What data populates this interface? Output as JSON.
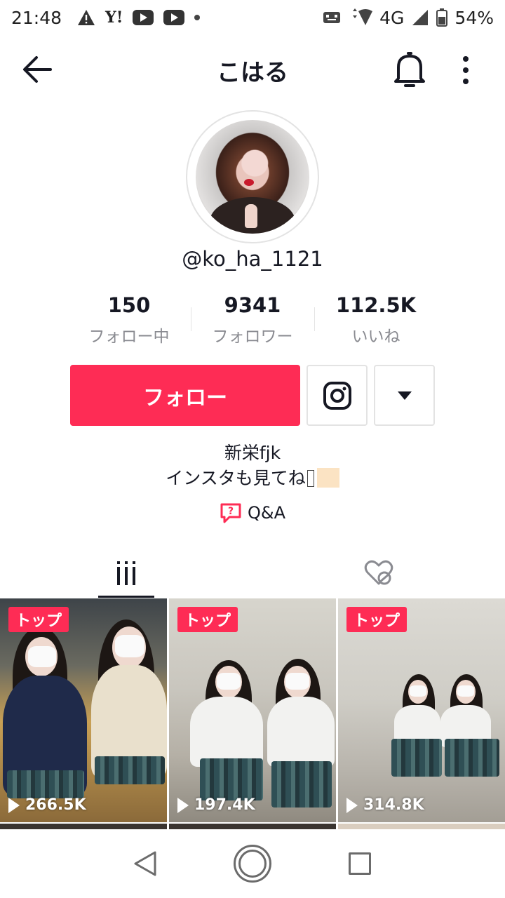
{
  "status_bar": {
    "time": "21:48",
    "network": "4G",
    "battery": "54%",
    "left_icons": [
      "warning-icon",
      "yahoo-icon",
      "youtube-icon",
      "youtube-icon",
      "dot-icon"
    ],
    "right_icons": [
      "vibrate-icon",
      "wifi-icon",
      "signal-icon",
      "battery-icon"
    ],
    "yahoo_label": "Y!"
  },
  "header": {
    "title": "こはる",
    "icons": [
      "back-arrow-icon",
      "bell-icon",
      "more-vertical-icon"
    ]
  },
  "profile": {
    "username": "@ko_ha_1121",
    "stats": [
      {
        "value": "150",
        "label": "フォロー中"
      },
      {
        "value": "9341",
        "label": "フォロワー"
      },
      {
        "value": "112.5K",
        "label": "いいね"
      }
    ],
    "follow_label": "フォロー",
    "bio_line1": "新栄fjk",
    "bio_line2": "インスタも見てね",
    "qa_label": "Q&A"
  },
  "tabs": {
    "items": [
      "videos-grid-icon",
      "liked-hidden-icon"
    ],
    "active": 0
  },
  "videos": [
    {
      "badge": "トップ",
      "views": "266.5K"
    },
    {
      "badge": "トップ",
      "views": "197.4K"
    },
    {
      "badge": "トップ",
      "views": "314.8K"
    }
  ],
  "colors": {
    "accent": "#fe2c55",
    "text": "#161823",
    "muted": "#8a8b91"
  }
}
